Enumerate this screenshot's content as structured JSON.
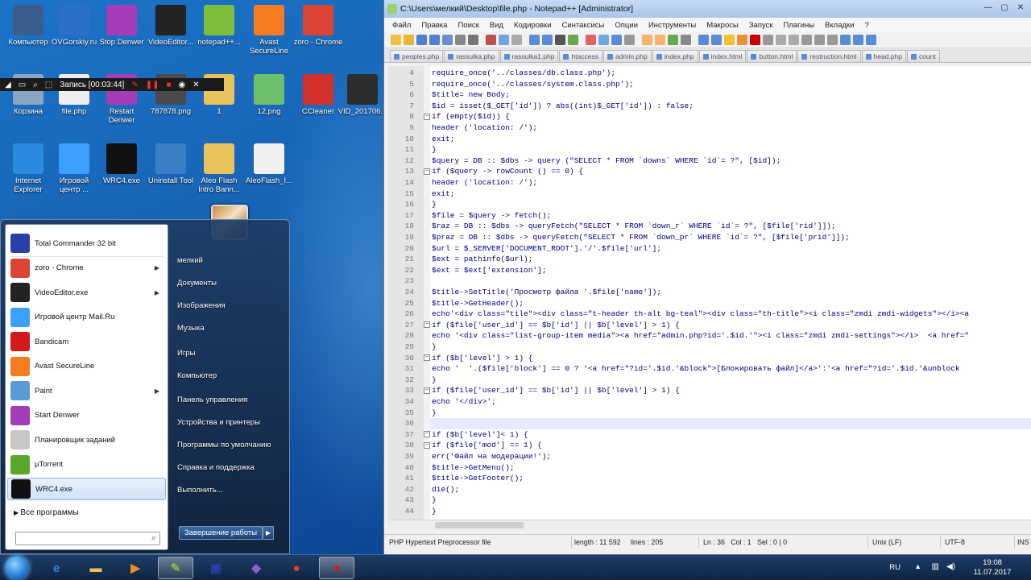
{
  "desktop": {
    "icons": [
      {
        "label": "Компьютер",
        "icon": "computer-icon",
        "color": "#3a5f8f"
      },
      {
        "label": "OVGorskiy.ru",
        "icon": "website-icon",
        "color": "#2a6fc9"
      },
      {
        "label": "Stop Denwer",
        "icon": "stop-denwer-icon",
        "color": "#a63db8"
      },
      {
        "label": "VideoEditor...",
        "icon": "video-editor-icon",
        "color": "#222222"
      },
      {
        "label": "notepad++...",
        "icon": "notepadpp-icon",
        "color": "#7dbf3a"
      },
      {
        "label": "Avast SecureLine",
        "icon": "avast-icon",
        "color": "#f47b20"
      },
      {
        "label": "zoro - Chrome",
        "icon": "chrome-icon",
        "color": "#db4437"
      },
      {
        "label": "Корзина",
        "icon": "recycle-bin-icon",
        "color": "#8aa6c4"
      },
      {
        "label": "file.php",
        "icon": "php-file-icon",
        "color": "#eeeeee"
      },
      {
        "label": "Restart Denwer",
        "icon": "restart-denwer-icon",
        "color": "#a63db8"
      },
      {
        "label": "787878.png",
        "icon": "image-file-icon",
        "color": "#4a4a4a"
      },
      {
        "label": "1",
        "icon": "folder-icon",
        "color": "#e8c25a"
      },
      {
        "label": "12.png",
        "icon": "image-file-icon",
        "color": "#6cc06c"
      },
      {
        "label": "CCleaner",
        "icon": "ccleaner-icon",
        "color": "#d2302a"
      },
      {
        "label": "VID_201706...",
        "icon": "video-file-icon",
        "color": "#2d2d2d"
      },
      {
        "label": "Internet Explorer",
        "icon": "ie-icon",
        "color": "#2a8ae0"
      },
      {
        "label": "Игровой центр ...",
        "icon": "game-center-icon",
        "color": "#3ca0ff"
      },
      {
        "label": "WRC4.exe",
        "icon": "wrc4-icon",
        "color": "#111111"
      },
      {
        "label": "Uninstall Tool",
        "icon": "uninstall-tool-icon",
        "color": "#3b7fc4"
      },
      {
        "label": "Aleo Flash Intro Bann...",
        "icon": "folder-icon",
        "color": "#e8c25a"
      },
      {
        "label": "AleoFlash_I...",
        "icon": "aleo-flash-icon",
        "color": "#f0f0f0"
      }
    ]
  },
  "recorder": {
    "label": "Запись [00:03:44]"
  },
  "start_menu": {
    "left_items": [
      {
        "label": "Total Commander 32 bit",
        "icon": "total-commander-icon",
        "color": "#2b3fa8",
        "arrow": false,
        "selected": false
      },
      {
        "label": "zoro - Chrome",
        "icon": "chrome-icon",
        "color": "#db4437",
        "arrow": true,
        "selected": false
      },
      {
        "label": "VideoEditor.exe",
        "icon": "video-editor-icon",
        "color": "#222222",
        "arrow": true,
        "selected": false
      },
      {
        "label": "Игровой центр Mail.Ru",
        "icon": "game-center-icon",
        "color": "#3ca0ff",
        "arrow": false,
        "selected": false
      },
      {
        "label": "Bandicam",
        "icon": "bandicam-icon",
        "color": "#d11a1a",
        "arrow": false,
        "selected": false
      },
      {
        "label": "Avast SecureLine",
        "icon": "avast-icon",
        "color": "#f47b20",
        "arrow": false,
        "selected": false
      },
      {
        "label": "Paint",
        "icon": "paint-icon",
        "color": "#5b9bd5",
        "arrow": true,
        "selected": false
      },
      {
        "label": "Start Denwer",
        "icon": "start-denwer-icon",
        "color": "#a63db8",
        "arrow": false,
        "selected": false
      },
      {
        "label": "Планировщик заданий",
        "icon": "task-scheduler-icon",
        "color": "#c8c8c8",
        "arrow": false,
        "selected": false
      },
      {
        "label": "µTorrent",
        "icon": "utorrent-icon",
        "color": "#5ea629",
        "arrow": false,
        "selected": false
      },
      {
        "label": "WRC4.exe",
        "icon": "wrc4-icon",
        "color": "#111111",
        "arrow": false,
        "selected": true
      }
    ],
    "all_programs": "Все программы",
    "search_placeholder": "",
    "right_items": [
      "мелкий",
      "Документы",
      "Изображения",
      "Музыка",
      "Игры",
      "Компьютер",
      "Панель управления",
      "Устройства и принтеры",
      "Программы по умолчанию",
      "Справка и поддержка",
      "Выполнить..."
    ],
    "shutdown": "Завершение работы"
  },
  "taskbar": {
    "items": [
      {
        "name": "ie",
        "icon": "ie-icon",
        "glyph": "e",
        "color": "#2a8ae0",
        "active": false
      },
      {
        "name": "explorer",
        "icon": "folder-icon",
        "glyph": "▬",
        "color": "#e8c25a",
        "active": false
      },
      {
        "name": "media-player",
        "icon": "media-player-icon",
        "glyph": "▶",
        "color": "#f08a24",
        "active": false
      },
      {
        "name": "notepadpp",
        "icon": "notepadpp-icon",
        "glyph": "✎",
        "color": "#7dbf3a",
        "active": true
      },
      {
        "name": "total-commander",
        "icon": "save-disk-icon",
        "glyph": "▣",
        "color": "#2b3fa8",
        "active": false
      },
      {
        "name": "visual-studio",
        "icon": "visual-studio-icon",
        "glyph": "◆",
        "color": "#8e5fc7",
        "active": false
      },
      {
        "name": "chrome",
        "icon": "chrome-icon",
        "glyph": "●",
        "color": "#db4437",
        "active": false
      },
      {
        "name": "bandicam",
        "icon": "bandicam-icon",
        "glyph": "●",
        "color": "#d11a1a",
        "active": true
      }
    ],
    "lang": "RU",
    "time": "19:08",
    "date": "11.07.2017"
  },
  "notepad": {
    "title": "C:\\Users\\мелкий\\Desktop\\file.php - Notepad++ [Administrator]",
    "menu": [
      "Файл",
      "Правка",
      "Поиск",
      "Вид",
      "Кодировки",
      "Синтаксисы",
      "Опции",
      "Инструменты",
      "Макросы",
      "Запуск",
      "Плагины",
      "Вкладки",
      "?"
    ],
    "tabs": [
      "peoples.php",
      "rassulka.php",
      "rassulka1.php",
      "htaccess",
      "admin.php",
      "index.php",
      "index.html",
      "button.html",
      "restruction.html",
      "head.php",
      "count"
    ],
    "code": [
      {
        "n": "4",
        "t": "require_once('../classes/db.class.php');"
      },
      {
        "n": "5",
        "t": "require_once('../classes/system.class.php');"
      },
      {
        "n": "6",
        "t": "$title= new Body;"
      },
      {
        "n": "7",
        "t": "$id = isset($_GET['id']) ? abs((int)$_GET['id']) : false;"
      },
      {
        "n": "8",
        "t": "if (empty($id)) {",
        "fold": true
      },
      {
        "n": "9",
        "t": "header ('location: /');"
      },
      {
        "n": "10",
        "t": "exit;"
      },
      {
        "n": "11",
        "t": "}"
      },
      {
        "n": "12",
        "t": "$query = DB :: $dbs -> query (\"SELECT * FROM `downs` WHERE `id`= ?\", [$id]);"
      },
      {
        "n": "13",
        "t": "if ($query -> rowCount () == 0) {",
        "fold": true
      },
      {
        "n": "14",
        "t": "header ('location: /');"
      },
      {
        "n": "15",
        "t": "exit;"
      },
      {
        "n": "16",
        "t": "}"
      },
      {
        "n": "17",
        "t": "$file = $query -> fetch();"
      },
      {
        "n": "18",
        "t": "$raz = DB :: $dbs -> queryFetch(\"SELECT * FROM `down_r` WHERE `id`= ?\", [$file['rid']]);"
      },
      {
        "n": "19",
        "t": "$praz = DB :: $dbs -> queryFetch(\"SELECT * FROM `down_pr` WHERE `id`= ?\", [$file['prid']]);"
      },
      {
        "n": "20",
        "t": "$url = $_SERVER['DOCUMENT_ROOT'].'/'.$file['url'];"
      },
      {
        "n": "21",
        "t": "$ext = pathinfo($url);"
      },
      {
        "n": "22",
        "t": "$ext = $ext['extension'];"
      },
      {
        "n": "23",
        "t": ""
      },
      {
        "n": "24",
        "t": "$title->SetTitle('Просмотр файла '.$file['name']);"
      },
      {
        "n": "25",
        "t": "$title->GetHeader();"
      },
      {
        "n": "26",
        "t": "echo'<div class=\"tile\"><div class=\"t-header th-alt bg-teal\"><div class=\"th-title\"><i class=\"zmdi zmdi-widgets\"></i><a"
      },
      {
        "n": "27",
        "t": "if ($file['user_id'] == $b['id'] || $b['level'] > 1) {",
        "fold": true
      },
      {
        "n": "28",
        "t": "echo '<div class=\"list-group-item media\"><a href=\"admin.php?id='.$id.'\"><i class=\"zmdi zmdi-settings\"></i>  <a href=\""
      },
      {
        "n": "29",
        "t": "}"
      },
      {
        "n": "30",
        "t": "if ($b['level'] > 1) {",
        "fold": true
      },
      {
        "n": "31",
        "t": "echo '  '.($file['block'] == 0 ? '<a href=\"?id='.$id.'&block\">[Блокировать файл]</a>':'<a href=\"?id='.$id.'&unblock"
      },
      {
        "n": "32",
        "t": "}"
      },
      {
        "n": "33",
        "t": "if ($file['user_id'] == $b['id'] || $b['level'] > 1) {",
        "fold": true
      },
      {
        "n": "34",
        "t": "echo '</div>';"
      },
      {
        "n": "35",
        "t": "}"
      },
      {
        "n": "36",
        "t": "",
        "current": true
      },
      {
        "n": "37",
        "t": "if ($b['level']< 1) {",
        "fold": true
      },
      {
        "n": "38",
        "t": "if ($file['mod'] == 1) {",
        "fold": true
      },
      {
        "n": "39",
        "t": "err('Файл на модерации!');"
      },
      {
        "n": "40",
        "t": "$title->GetMenu();"
      },
      {
        "n": "41",
        "t": "$title->GetFooter();"
      },
      {
        "n": "42",
        "t": "die();"
      },
      {
        "n": "43",
        "t": "}"
      },
      {
        "n": "44",
        "t": "}"
      }
    ],
    "status": {
      "filetype": "PHP Hypertext Preprocessor file",
      "length": "length : 11 592",
      "lines": "lines : 205",
      "pos": "Ln : 36   Col : 1   Sel : 0 | 0",
      "eol": "Unix (LF)",
      "enc": "UTF-8",
      "ins": "INS"
    }
  }
}
